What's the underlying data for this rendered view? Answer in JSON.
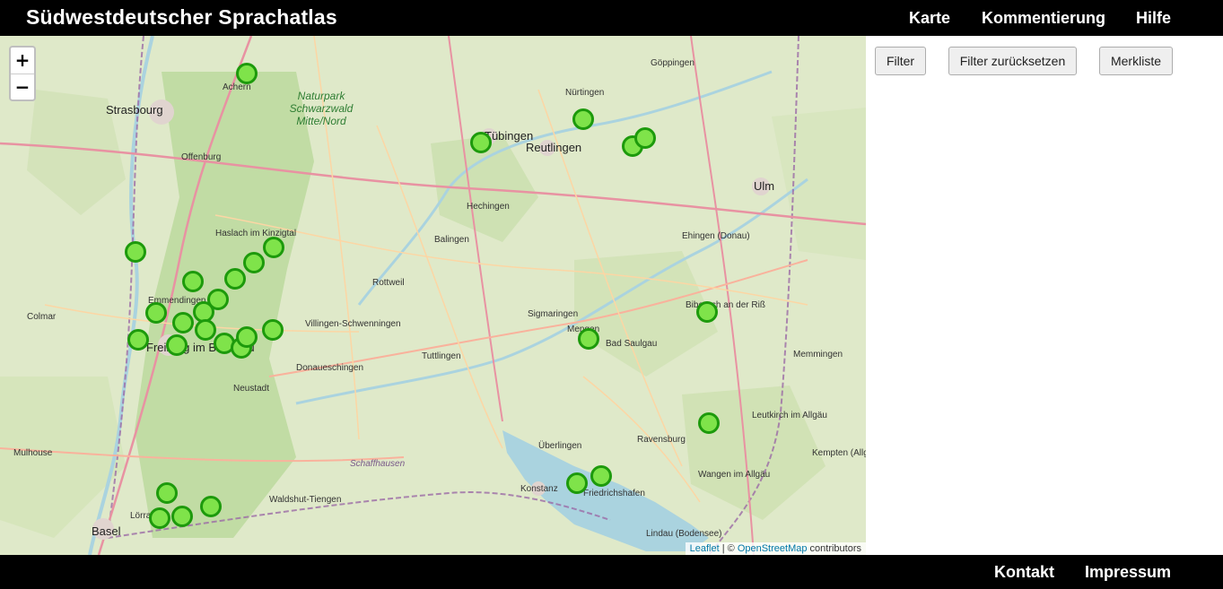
{
  "header": {
    "title": "Südwestdeutscher Sprachatlas",
    "nav": [
      "Karte",
      "Kommentierung",
      "Hilfe"
    ]
  },
  "toolbar": {
    "filter_label": "Filter",
    "reset_label": "Filter zurücksetzen",
    "merkliste_label": "Merkliste"
  },
  "map": {
    "zoom_in": "+",
    "zoom_out": "−",
    "attribution_leaflet": "Leaflet",
    "attribution_sep": " | © ",
    "attribution_osm": "OpenStreetMap",
    "attribution_suffix": " contributors",
    "labels": {
      "strasbourg": "Strasbourg",
      "freiburg": "Freiburg im Breisgau",
      "basel": "Basel",
      "tuebingen": "Tübingen",
      "reutlingen": "Reutlingen",
      "ulm": "Ulm",
      "konstanz": "Konstanz",
      "friedrichshafen": "Friedrichshafen",
      "ravensburg": "Ravensburg",
      "rottweil": "Rottweil",
      "sigmaringen": "Sigmaringen",
      "villingen": "Villingen-Schwenningen",
      "donaueschingen": "Donaueschingen",
      "offenburg": "Offenburg",
      "emmendingen": "Emmendingen",
      "biberach": "Biberach an der Riß",
      "ueberlingen": "Überlingen",
      "memmingen": "Memmingen",
      "mulhouse": "Mulhouse",
      "colmar": "Colmar",
      "park": "Naturpark Schwarzwald Mitte/Nord",
      "schaffhausen": "Schaffhausen",
      "lindau": "Lindau (Bodensee)",
      "kempten": "Kempten (Allgäu)",
      "achern": "Achern",
      "nuertingen": "Nürtingen",
      "goeppingen": "Göppingen",
      "balingen": "Balingen",
      "tuttlingen": "Tuttlingen",
      "leutkirch": "Leutkirch im Allgäu",
      "loerrach": "Lörrach",
      "waldshut": "Waldshut-Tiengen",
      "neustadt": "Neustadt",
      "hechingen": "Hechingen",
      "ehingen": "Ehingen (Donau)",
      "bad_saulgau": "Bad Saulgau",
      "mengen": "Mengen",
      "wangen": "Wangen im Allgäu",
      "haslach": "Haslach im Kinzigtal"
    }
  },
  "footer": {
    "kontakt": "Kontakt",
    "impressum": "Impressum"
  }
}
